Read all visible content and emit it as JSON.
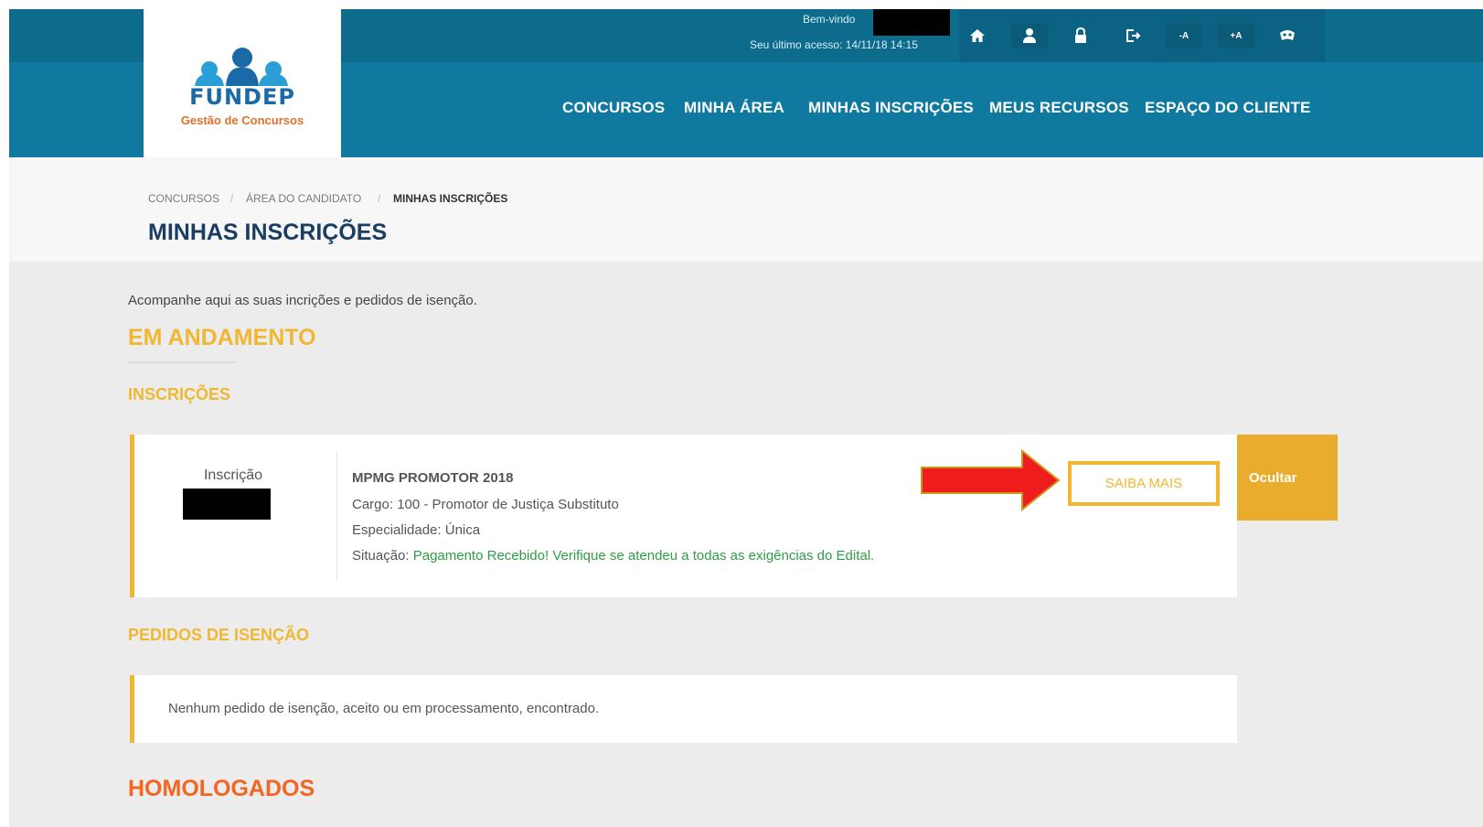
{
  "header": {
    "logo": {
      "brand": "FUNDEP",
      "tagline": "Gestão de Concursos"
    },
    "welcome_label": "Bem-vindo",
    "last_access": "Seu último acesso: 14/11/18 14:15",
    "toolbar_icons": [
      {
        "name": "home-icon",
        "glyph": "⌂"
      },
      {
        "name": "user-icon",
        "glyph": "👤"
      },
      {
        "name": "lock-icon",
        "glyph": "🔒"
      },
      {
        "name": "logout-icon",
        "glyph": "⇥"
      },
      {
        "name": "font-decrease-icon",
        "glyph": "-A"
      },
      {
        "name": "font-increase-icon",
        "glyph": "+A"
      },
      {
        "name": "accessibility-icon",
        "glyph": "◉"
      }
    ],
    "nav": [
      "CONCURSOS",
      "MINHA ÁREA",
      "MINHAS INSCRIÇÕES",
      "MEUS RECURSOS",
      "ESPAÇO DO CLIENTE"
    ]
  },
  "breadcrumb": [
    "CONCURSOS",
    "ÁREA DO CANDIDATO",
    "MINHAS INSCRIÇÕES"
  ],
  "page_title": "MINHAS INSCRIÇÕES",
  "intro": "Acompanhe aqui as suas incrições e pedidos de isenção.",
  "section_title": "EM ANDAMENTO",
  "inscricoes": {
    "title": "INSCRIÇÕES",
    "card": {
      "label": "Inscrição",
      "exam_title": "MPMG PROMOTOR 2018",
      "cargo": "Cargo: 100 - Promotor de Justiça Substituto",
      "especialidade": "Especialidade: Única",
      "situacao_label": "Situação: ",
      "situacao_value": "Pagamento Recebido! Verifique se atendeu a todas as exigências do Edital.",
      "saiba_mais": "SAIBA MAIS",
      "ocultar": "Ocultar"
    }
  },
  "isencao": {
    "title": "PEDIDOS DE ISENÇÃO",
    "empty_message": "Nenhum pedido de isenção, aceito ou em processamento, encontrado."
  },
  "homologados_title": "HOMOLOGADOS",
  "colors": {
    "header_dark": "#0d6b8c",
    "header": "#0f79a0",
    "accent_yellow": "#f0b731",
    "title_blue": "#1a3d63",
    "status_green": "#2e9e44",
    "homologados_orange": "#f26522",
    "annotation_arrow": "#ee1c1c"
  }
}
